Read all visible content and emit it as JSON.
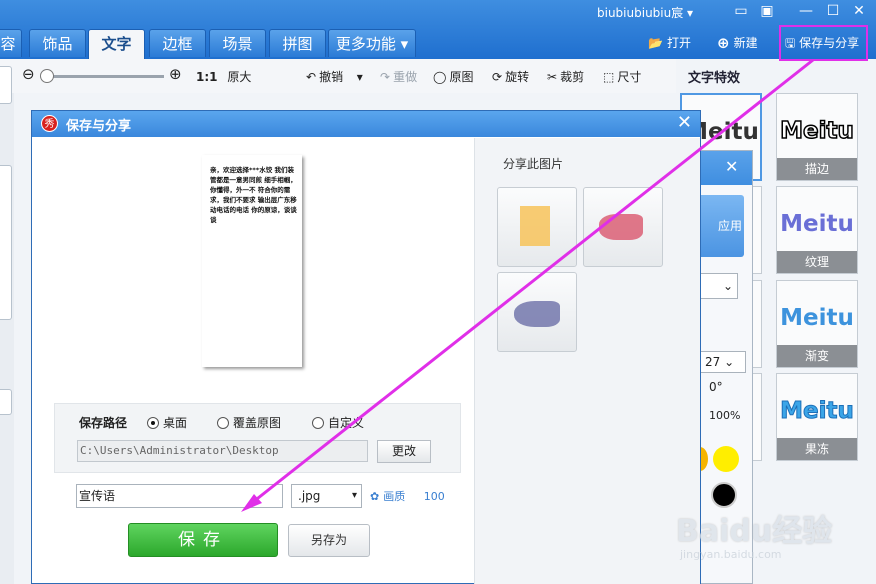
{
  "header": {
    "user_name": "biubiubiubiu宸",
    "tabs": [
      {
        "label": "容"
      },
      {
        "label": "饰品"
      },
      {
        "label": "文字"
      },
      {
        "label": "边框"
      },
      {
        "label": "场景"
      },
      {
        "label": "拼图"
      },
      {
        "label": "更多功能"
      }
    ],
    "open_label": "打开",
    "new_label": "新建",
    "save_share_label": "保存与分享",
    "highlight_color": "#e02fe8"
  },
  "toolbar": {
    "ratio_label": "1:1",
    "original_size_label": "原大",
    "undo_label": "撤销",
    "redo_label": "重做",
    "original_image_label": "原图",
    "rotate_label": "旋转",
    "crop_label": "裁剪",
    "size_label": "尺寸"
  },
  "right_panel": {
    "title": "文字特效",
    "effects": [
      {
        "word": "Meitu",
        "label": ""
      },
      {
        "word": "Meitu",
        "label": "描边"
      },
      {
        "word": "Meitu",
        "label": "纹理"
      },
      {
        "word": "Meitu",
        "label": "渐变"
      },
      {
        "word": "Meitu",
        "label": "果冻"
      }
    ]
  },
  "bg_dialog": {
    "apply_label": "应用",
    "font_size": "27",
    "angle": "0°",
    "opacity": "100%"
  },
  "dialog": {
    "title": "保存与分享",
    "preview_text": "亲，欢迎选择***水饺 我们装管都是一意男同煎 细手相帼，你懂得，外一不 符合你的需求，我们不要求 输出层广东移动电话的电话 你的原谅，谈谈谈",
    "path_label": "保存路径",
    "radio_desktop": "桌面",
    "radio_overwrite": "覆盖原图",
    "radio_custom": "自定义",
    "path_value": "C:\\Users\\Administrator\\Desktop",
    "change_label": "更改",
    "file_name": "宣传语",
    "format": ".jpg",
    "quality_label": "画质",
    "quality_value": "100",
    "save_label": "保存",
    "save_as_label": "另存为",
    "share_title": "分享此图片",
    "accent_color": "#2ca82c"
  },
  "watermark": {
    "text": "Baidu经验",
    "sub": "jingyan.baidu.com"
  }
}
